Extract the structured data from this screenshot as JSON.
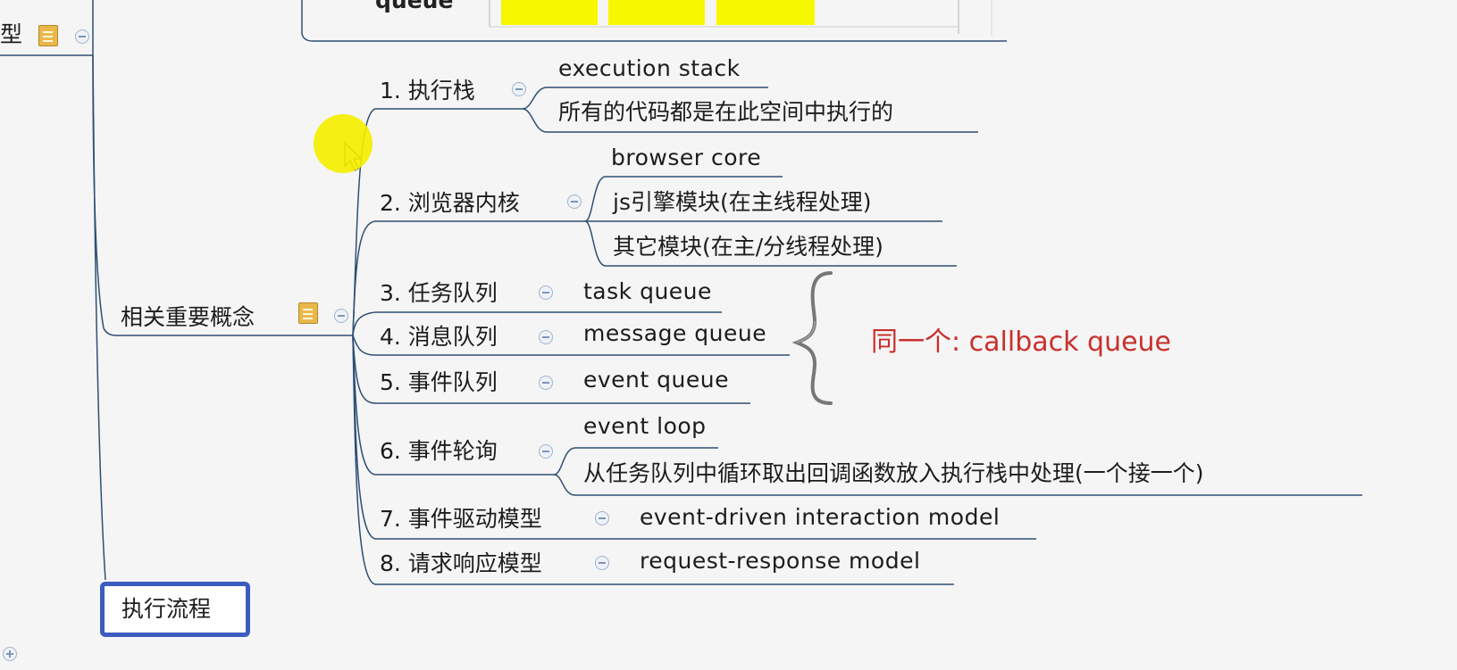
{
  "top_fragment": {
    "label": "queue"
  },
  "left_node": {
    "label": "型"
  },
  "main_node": {
    "label": "相关重要概念"
  },
  "exec_node": {
    "label": "执行流程"
  },
  "branches": [
    {
      "label": "1. 执行栈",
      "children": [
        "execution stack",
        "所有的代码都是在此空间中执行的"
      ]
    },
    {
      "label": "2. 浏览器内核",
      "children": [
        "browser core",
        "js引擎模块(在主线程处理)",
        "其它模块(在主/分线程处理)"
      ]
    },
    {
      "label": "3. 任务队列",
      "children": [
        "task queue"
      ]
    },
    {
      "label": "4. 消息队列",
      "children": [
        "message queue"
      ]
    },
    {
      "label": "5. 事件队列",
      "children": [
        "event queue"
      ]
    },
    {
      "label": "6. 事件轮询",
      "children": [
        "event loop",
        "从任务队列中循环取出回调函数放入执行栈中处理(一个接一个)"
      ]
    },
    {
      "label": "7. 事件驱动模型",
      "children": [
        "event-driven interaction model"
      ]
    },
    {
      "label": "8. 请求响应模型",
      "children": [
        "request-response model"
      ]
    }
  ],
  "callout": {
    "text": "同一个: callback queue"
  },
  "colors": {
    "line": "#2f4f73",
    "callout": "#c9302c",
    "highlight": "#f7f700",
    "selected_border": "#3b5cbf"
  },
  "icons": [
    "note-icon",
    "collapse-icon",
    "expand-icon",
    "cursor-icon",
    "brace-icon"
  ]
}
